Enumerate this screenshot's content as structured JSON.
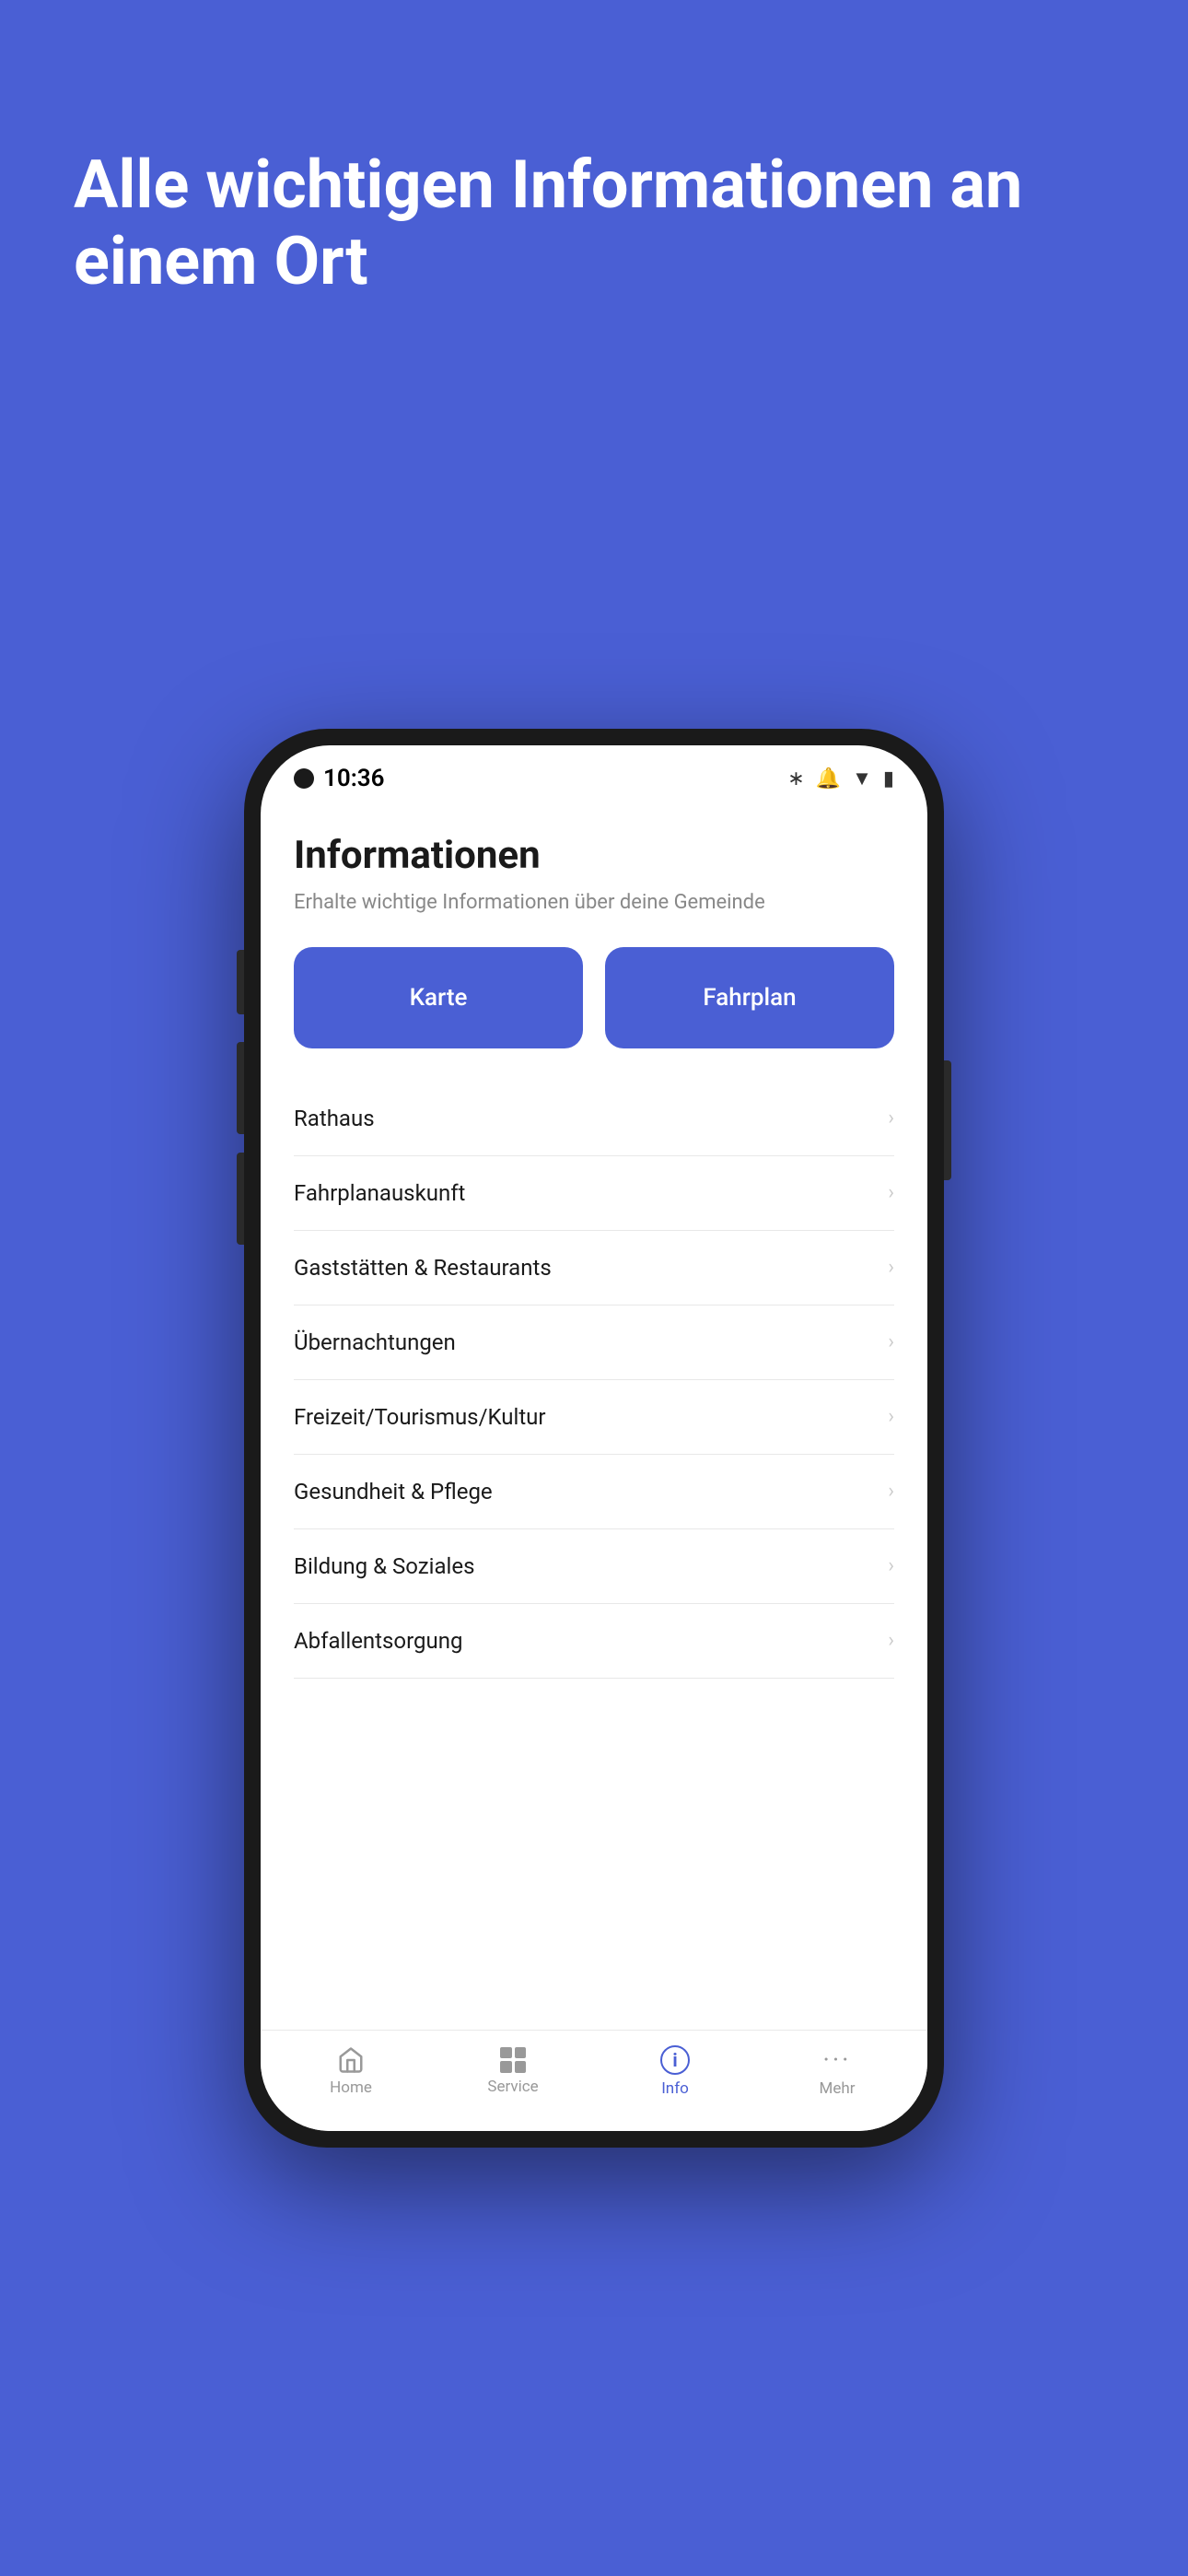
{
  "background": {
    "color": "#4A5FD4"
  },
  "hero": {
    "title": "Alle wichtigen Informationen an einem Ort"
  },
  "phone": {
    "status_bar": {
      "time": "10:36"
    },
    "app": {
      "title": "Informationen",
      "subtitle": "Erhalte wichtige Informationen über deine Gemeinde",
      "quick_actions": [
        {
          "label": "Karte",
          "id": "karte"
        },
        {
          "label": "Fahrplan",
          "id": "fahrplan"
        }
      ],
      "list_items": [
        {
          "label": "Rathaus"
        },
        {
          "label": "Fahrplanauskunft"
        },
        {
          "label": "Gaststätten & Restaurants"
        },
        {
          "label": "Übernachtungen"
        },
        {
          "label": "Freizeit/Tourismus/Kultur"
        },
        {
          "label": "Gesundheit & Pflege"
        },
        {
          "label": "Bildung & Soziales"
        },
        {
          "label": "Abfallentsorgung"
        }
      ]
    },
    "bottom_nav": [
      {
        "label": "Home",
        "id": "home",
        "active": false
      },
      {
        "label": "Service",
        "id": "service",
        "active": false
      },
      {
        "label": "Info",
        "id": "info",
        "active": true
      },
      {
        "label": "Mehr",
        "id": "mehr",
        "active": false
      }
    ]
  }
}
